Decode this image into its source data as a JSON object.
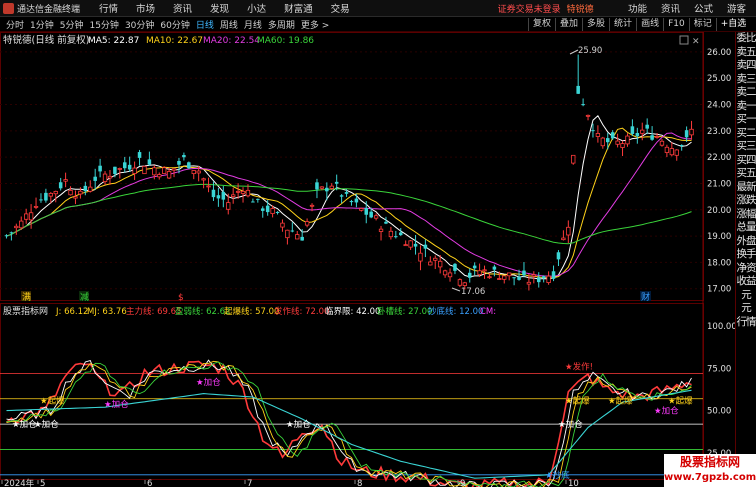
{
  "window": {
    "app_title": "通达信金融终端",
    "menus": [
      "行情",
      "市场",
      "资讯",
      "发现",
      "小达",
      "财富通",
      "交易"
    ],
    "notice": "证券交易未登录",
    "notice_stock": "特锐德",
    "right_menus": [
      "功能",
      "资讯",
      "公式",
      "游客"
    ]
  },
  "toolbar": {
    "periods": [
      "分时",
      "1分钟",
      "5分钟",
      "15分钟",
      "30分钟",
      "60分钟",
      "日线",
      "周线",
      "月线",
      "多周期",
      "更多 >"
    ],
    "active_period": "日线",
    "right_buttons": [
      "复权",
      "叠加",
      "多股",
      "统计",
      "画线",
      "F10",
      "标记",
      "+自选"
    ]
  },
  "main_panel": {
    "title": "特锐德(日线 前复权)",
    "ma": [
      {
        "label": "MA5: 22.87",
        "color": "#ffffff"
      },
      {
        "label": "MA10: 22.67",
        "color": "#ffd21a"
      },
      {
        "label": "MA20: 22.54",
        "color": "#e23ce2"
      },
      {
        "label": "MA60: 19.86",
        "color": "#3ad43a"
      }
    ],
    "high_label": "25.90",
    "low_label": "17.06",
    "y_ticks": [
      "26.00",
      "25.00",
      "24.00",
      "23.00",
      "22.00",
      "21.00",
      "20.00",
      "19.00",
      "18.00",
      "17.00"
    ],
    "markers": [
      {
        "text": "满",
        "color": "#ffd21a"
      },
      {
        "text": "减",
        "color": "#3ad43a"
      },
      {
        "text": "$",
        "color": "#ff3b3b"
      },
      {
        "text": "财",
        "color": "#3aa0ff"
      }
    ]
  },
  "indicator_panel": {
    "name": "股票指标网",
    "labels": [
      {
        "label": "J: 66.12",
        "color": "#ffd21a"
      },
      {
        "label": "MJ: 63.76",
        "color": "#ffd21a"
      },
      {
        "label": "主力线: 69.65",
        "color": "#ff3b3b"
      },
      {
        "label": "盈弱线: 62.62",
        "color": "#3ad43a"
      },
      {
        "label": "起爆线: 57.00",
        "color": "#ffd21a"
      },
      {
        "label": "发作线: 72.00",
        "color": "#ff3b3b"
      },
      {
        "label": "临界限: 42.00",
        "color": "#ffffff"
      },
      {
        "label": "卧槽线: 27.00",
        "color": "#3ad43a"
      },
      {
        "label": "抄底线: 12.00",
        "color": "#3aa0ff"
      },
      {
        "label": "CM: ",
        "color": "#ff3bff"
      }
    ],
    "y_ticks": [
      "100.00",
      "75.00",
      "50.00",
      "25.00"
    ],
    "signals": [
      {
        "text": "★加仓",
        "color": "#ffffff"
      },
      {
        "text": "★加仓",
        "color": "#ffffff"
      },
      {
        "text": "★起爆",
        "color": "#ffd21a"
      },
      {
        "text": "★加仓",
        "color": "#ff3bff"
      },
      {
        "text": "★加仓",
        "color": "#ff3bff"
      },
      {
        "text": "★加仓",
        "color": "#ffffff"
      },
      {
        "text": "★发作!",
        "color": "#ff3b3b"
      },
      {
        "text": "★起爆",
        "color": "#ffd21a"
      },
      {
        "text": "★加仓",
        "color": "#ffffff"
      },
      {
        "text": "★起爆",
        "color": "#ffd21a"
      },
      {
        "text": "★起爆",
        "color": "#ffd21a"
      },
      {
        "text": "★加仓",
        "color": "#ff3bff"
      },
      {
        "text": "★抄底",
        "color": "#3aa0ff"
      }
    ]
  },
  "x_axis": [
    "2024年",
    "5",
    "6",
    "7",
    "8",
    "9",
    "10"
  ],
  "side_panel": [
    "委比",
    "卖五",
    "卖四",
    "卖三",
    "卖二",
    "卖一",
    "买一",
    "买二",
    "买三",
    "买四",
    "买五",
    "最新",
    "涨跌",
    "涨幅",
    "总量",
    "外盘",
    "换手",
    "净资",
    "收益",
    "元",
    "元",
    "行情"
  ],
  "watermark": {
    "top": "股票指标网",
    "bottom": "www.7gpzb.com"
  },
  "colors": {
    "up": "#ff3b3b",
    "down": "#3ad4d4",
    "grid": "#5a0000",
    "bg": "#000000"
  }
}
